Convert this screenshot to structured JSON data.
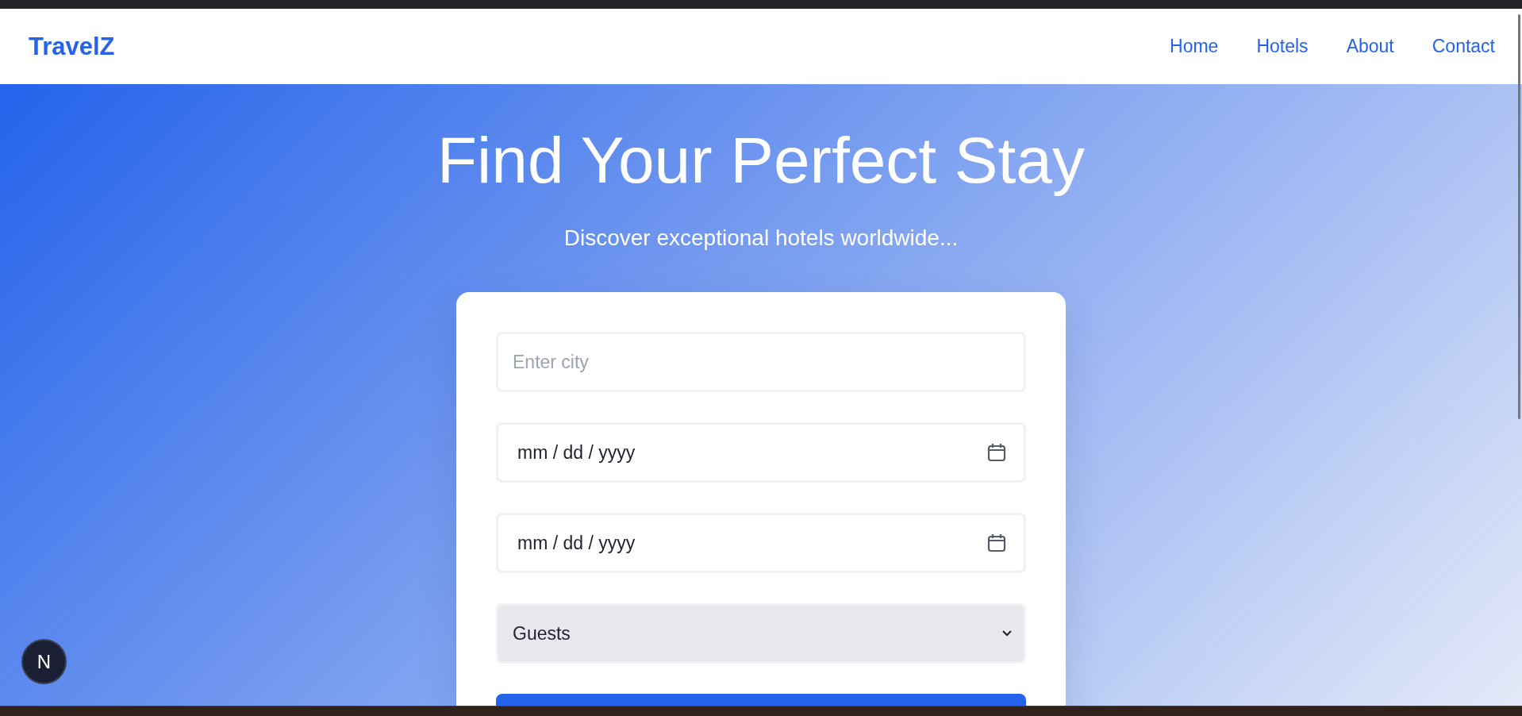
{
  "nav": {
    "logo": "TravelZ",
    "links": [
      {
        "label": "Home"
      },
      {
        "label": "Hotels"
      },
      {
        "label": "About"
      },
      {
        "label": "Contact"
      }
    ]
  },
  "hero": {
    "title": "Find Your Perfect Stay",
    "subtitle": "Discover exceptional hotels worldwide..."
  },
  "search_form": {
    "city": {
      "placeholder": "Enter city"
    },
    "check_in": {
      "value": "mm / dd / yyyy"
    },
    "check_out": {
      "value": "mm / dd / yyyy"
    },
    "guests": {
      "value": "Guests"
    }
  },
  "dev_badge": {
    "label": "N"
  }
}
